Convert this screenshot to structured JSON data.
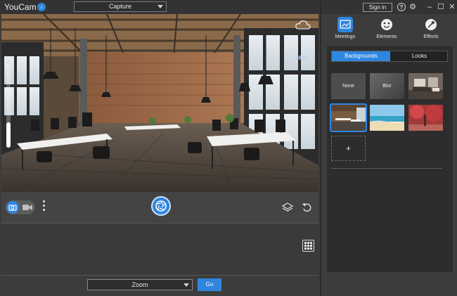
{
  "window": {
    "app_title": "YouCam",
    "mode_select": "Capture",
    "signin_label": "Sign in",
    "icons": [
      "help-icon",
      "gear-icon",
      "minimize-icon",
      "maximize-icon",
      "close-icon"
    ]
  },
  "preview": {
    "hdr_label": "HDR",
    "zoom_level": 0.3
  },
  "toolbar": {
    "icons": [
      "camera-icon",
      "video-toggle-icon",
      "more-options-icon",
      "shutter-icon",
      "layers-icon",
      "undo-icon"
    ]
  },
  "bottom": {
    "zoom_select": "Zoom",
    "go_label": "Go"
  },
  "panel": {
    "categories": [
      {
        "label": "Meetings",
        "icon": "meetings-icon",
        "active": true
      },
      {
        "label": "Elements",
        "icon": "elements-icon",
        "active": false
      },
      {
        "label": "Effects",
        "icon": "effects-icon",
        "active": false
      }
    ],
    "tabs": [
      {
        "label": "Backgrounds",
        "active": true
      },
      {
        "label": "Looks",
        "active": false
      }
    ],
    "backgrounds": [
      {
        "label": "None"
      },
      {
        "label": "Blur"
      },
      {
        "label": ""
      },
      {
        "label": ""
      },
      {
        "label": ""
      },
      {
        "label": ""
      }
    ],
    "add_label": "+"
  },
  "colors": {
    "accent": "#2e86de",
    "window_bg": "#3c3c3c",
    "panel_content_bg": "#2d2d2d"
  }
}
